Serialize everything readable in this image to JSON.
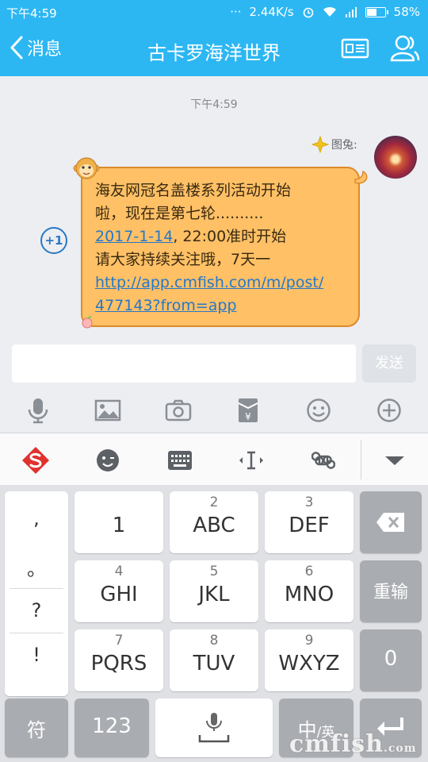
{
  "status_bar": {
    "time": "下午4:59",
    "dots": "···",
    "speed": "2.44K/s",
    "battery": "58%",
    "battery_level": 0.58
  },
  "nav": {
    "back_label": "消息",
    "title": "古卡罗海洋世界"
  },
  "chat": {
    "timestamp": "下午4:59",
    "sender": "图兔:",
    "plus_one": "+1",
    "message": {
      "line1": "海友网冠名盖楼系列活动开始",
      "line2": "啦，现在是第七轮..........",
      "date_link": "2017-1-14",
      "line3_rest": ", 22:00准时开始",
      "line4": "请大家持续关注哦，7天一",
      "url_line1": "http://app.cmfish.com/m/post/",
      "url_line2": "477143?from=app"
    }
  },
  "composer": {
    "send_label": "发送",
    "input_value": ""
  },
  "tools": [
    "mic-icon",
    "image-icon",
    "camera-icon",
    "red-envelope-icon",
    "emoji-icon",
    "plus-icon"
  ],
  "ime_bar": [
    "sogou-logo-icon",
    "emoji-wink-icon",
    "keyboard-icon",
    "cursor-icon",
    "command-icon",
    "collapse-icon"
  ],
  "keyboard": {
    "punct": [
      ",",
      "。",
      "?",
      "!"
    ],
    "keys": [
      {
        "num": "",
        "main": "1"
      },
      {
        "num": "2",
        "main": "ABC"
      },
      {
        "num": "3",
        "main": "DEF"
      },
      {
        "num": "4",
        "main": "GHI"
      },
      {
        "num": "5",
        "main": "JKL"
      },
      {
        "num": "6",
        "main": "MNO"
      },
      {
        "num": "7",
        "main": "PQRS"
      },
      {
        "num": "8",
        "main": "TUV"
      },
      {
        "num": "9",
        "main": "WXYZ"
      }
    ],
    "reenter": "重输",
    "zero": "0",
    "symbols": "符",
    "num_mode": "123",
    "lang_main": "中",
    "lang_sub": "/英"
  },
  "watermark": {
    "main": "cmfish",
    "sub": ".com"
  }
}
